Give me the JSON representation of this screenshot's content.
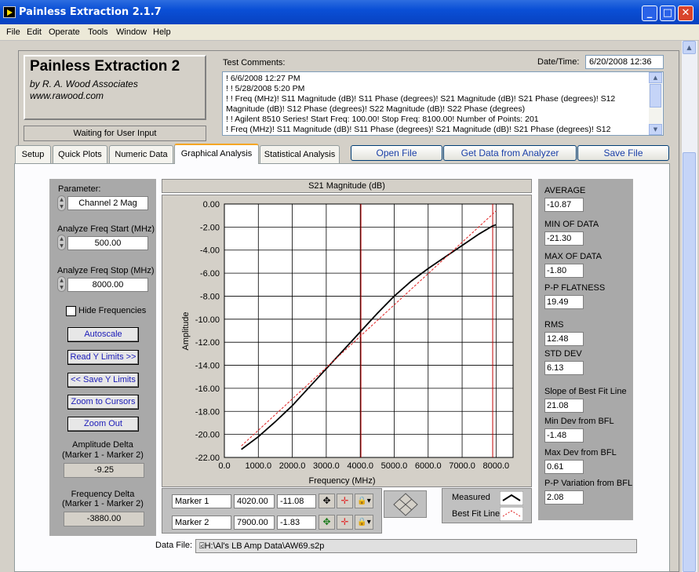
{
  "window": {
    "title": "Painless Extraction 2.1.7"
  },
  "menu": [
    "File",
    "Edit",
    "Operate",
    "Tools",
    "Window",
    "Help"
  ],
  "logo": {
    "title": "Painless Extraction 2",
    "by": "by R. A. Wood Associates",
    "url": "www.rawood.com"
  },
  "status": "Waiting for User Input",
  "comments": {
    "label": "Test Comments:",
    "lines": [
      "! 6/6/2008 12:27 PM",
      "! ! 5/28/2008 5:20 PM",
      "! ! Freq (MHz)! S11 Magnitude (dB)! S11 Phase (degrees)! S21 Magnitude (dB)! S21 Phase (degrees)! S12",
      "Magnitude (dB)! S12 Phase (degrees)! S22 Magnitude (dB)! S22 Phase (degrees)",
      "! ! Agilent 8510 Series! Start Freq: 100.00! Stop Freq: 8100.00! Number of Points: 201",
      "! Freq (MHz)! S11 Magnitude (dB)! S11 Phase (degrees)! S21 Magnitude (dB)! S21 Phase (degrees)! S12"
    ]
  },
  "datetime": {
    "label": "Date/Time:",
    "value": "6/20/2008  12:36"
  },
  "tabs": [
    "Setup",
    "Quick Plots",
    "Numeric Data",
    "Graphical Analysis",
    "Statistical Analysis"
  ],
  "active_tab": "Graphical Analysis",
  "top_buttons": {
    "open": "Open File",
    "get": "Get Data from Analyzer",
    "save": "Save File"
  },
  "left": {
    "parameter_label": "Parameter:",
    "parameter_value": "Channel 2 Mag",
    "start_label": "Analyze Freq Start (MHz)",
    "start_value": "500.00",
    "stop_label": "Analyze Freq Stop (MHz)",
    "stop_value": "8000.00",
    "hide_freq": "Hide Frequencies",
    "btn_autoscale": "Autoscale",
    "btn_read": "Read Y Limits >>",
    "btn_save": "<< Save Y Limits",
    "btn_zoom_cursors": "Zoom to Cursors",
    "btn_zoom_out": "Zoom Out",
    "amp_delta_label1": "Amplitude Delta",
    "amp_delta_label2": "(Marker 1 - Marker 2)",
    "amp_delta_value": "-9.25",
    "freq_delta_label1": "Frequency Delta",
    "freq_delta_label2": "(Marker 1 - Marker 2)",
    "freq_delta_value": "-3880.00"
  },
  "stats": [
    {
      "label": "AVERAGE",
      "value": "-10.87"
    },
    {
      "label": "MIN OF DATA",
      "value": "-21.30"
    },
    {
      "label": "MAX OF DATA",
      "value": "-1.80"
    },
    {
      "label": "P-P FLATNESS",
      "value": "19.49"
    },
    {
      "label": "RMS",
      "value": "12.48"
    },
    {
      "label": "STD DEV",
      "value": "6.13"
    },
    {
      "label": "Slope of Best Fit Line",
      "value": "21.08"
    },
    {
      "label": "Min Dev from BFL",
      "value": "-1.48"
    },
    {
      "label": "Max Dev from BFL",
      "value": "0.61"
    },
    {
      "label": "P-P Variation from BFL",
      "value": "2.08"
    }
  ],
  "markers": [
    {
      "name": "Marker 1",
      "freq": "4020.00",
      "amp": "-11.08"
    },
    {
      "name": "Marker 2",
      "freq": "7900.00",
      "amp": "-1.83"
    }
  ],
  "legend": {
    "measured": "Measured",
    "bfl": "Best Fit Line"
  },
  "datafile": {
    "label": "Data File:",
    "path": "H:\\Al's LB Amp Data\\AW69.s2p"
  },
  "colors": {
    "measured": "#000000",
    "bfl": "#e02020",
    "cursor": "#c00000",
    "grid": "#000000"
  },
  "chart_data": {
    "type": "line",
    "title": "S21 Magnitude (dB)",
    "xlabel": "Frequency (MHz)",
    "ylabel": "Amplitude",
    "xlim": [
      0,
      8500
    ],
    "ylim": [
      -22,
      0
    ],
    "xticks": [
      "0.0",
      "1000.0",
      "2000.0",
      "3000.0",
      "4000.0",
      "5000.0",
      "6000.0",
      "7000.0",
      "8000.0"
    ],
    "yticks": [
      "0.00",
      "-2.00",
      "-4.00",
      "-6.00",
      "-8.00",
      "-10.00",
      "-12.00",
      "-14.00",
      "-16.00",
      "-18.00",
      "-20.00",
      "-22.00"
    ],
    "grid": true,
    "cursors_x": [
      4020,
      7900
    ],
    "series": [
      {
        "name": "Measured",
        "x": [
          500,
          1000,
          1500,
          2000,
          2500,
          3000,
          3500,
          4000,
          4500,
          5000,
          5500,
          6000,
          6500,
          7000,
          7500,
          7900,
          8000
        ],
        "y": [
          -21.3,
          -20.2,
          -18.9,
          -17.5,
          -15.9,
          -14.3,
          -12.7,
          -11.1,
          -9.5,
          -8.0,
          -6.7,
          -5.6,
          -4.6,
          -3.6,
          -2.6,
          -1.9,
          -1.8
        ]
      },
      {
        "name": "Best Fit Line",
        "x": [
          500,
          8000
        ],
        "y": [
          -21.0,
          -0.6
        ]
      }
    ]
  }
}
